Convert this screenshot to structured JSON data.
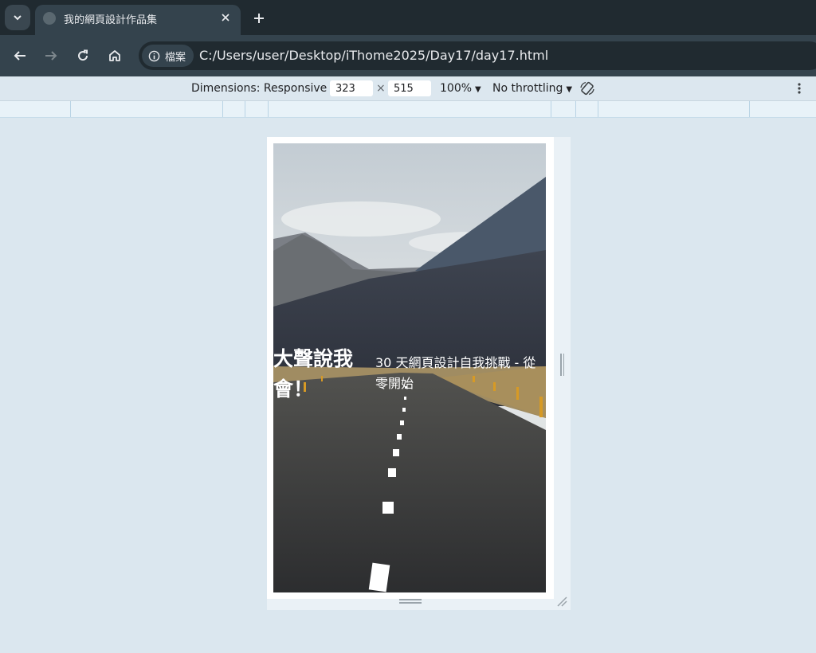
{
  "browser": {
    "tab": {
      "title": "我的網頁設計作品集"
    },
    "site_info_label": "檔案",
    "url": "C:/Users/user/Desktop/iThome2025/Day17/day17.html"
  },
  "devtools": {
    "dimensions_label": "Dimensions: Responsive",
    "width": "323",
    "separator": "×",
    "height": "515",
    "zoom": "100%",
    "throttling": "No throttling"
  },
  "page": {
    "hero_title": "大聲說我會！",
    "hero_subtitle": "30 天網頁設計自我挑戰 - 從零開始"
  },
  "colors": {
    "chrome_dark": "#202a30",
    "chrome_mid": "#34434d",
    "devtools_bg": "#dbe7ef"
  }
}
